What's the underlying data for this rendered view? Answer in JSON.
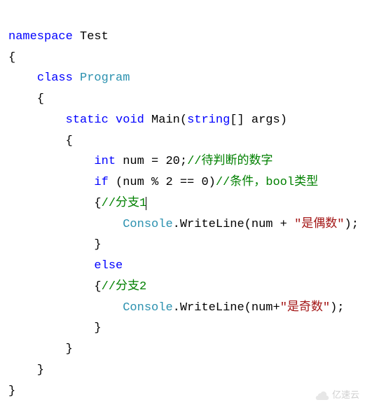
{
  "code": {
    "l1_kw": "namespace",
    "l1_name": " Test",
    "l2": "{",
    "l3_kw": "class",
    "l3_name": " Program",
    "l4": "    {",
    "l5_kw1": "static",
    "l5_kw2": " void",
    "l5_method": " Main(",
    "l5_kw3": "string",
    "l5_rest": "[] args)",
    "l6": "        {",
    "l7_kw": "int",
    "l7_rest": " num = 20;",
    "l7_cmt": "//待判断的数字",
    "l8_kw": "if",
    "l8_rest": " (num % 2 == 0)",
    "l8_cmt": "//条件，bool类型",
    "l9_brace": "            {",
    "l9_cmt": "//分支1",
    "l10_type": "Console",
    "l10_rest": ".WriteLine(num + ",
    "l10_str": "\"是偶数\"",
    "l10_end": ");",
    "l11": "            }",
    "l12_kw": "else",
    "l13_brace": "            {",
    "l13_cmt": "//分支2",
    "l14_type": "Console",
    "l14_rest": ".WriteLine(num+",
    "l14_str": "\"是奇数\"",
    "l14_end": ");",
    "l15": "            }",
    "l16": "        }",
    "l17": "    }",
    "l18": "}"
  },
  "watermark": "亿速云"
}
